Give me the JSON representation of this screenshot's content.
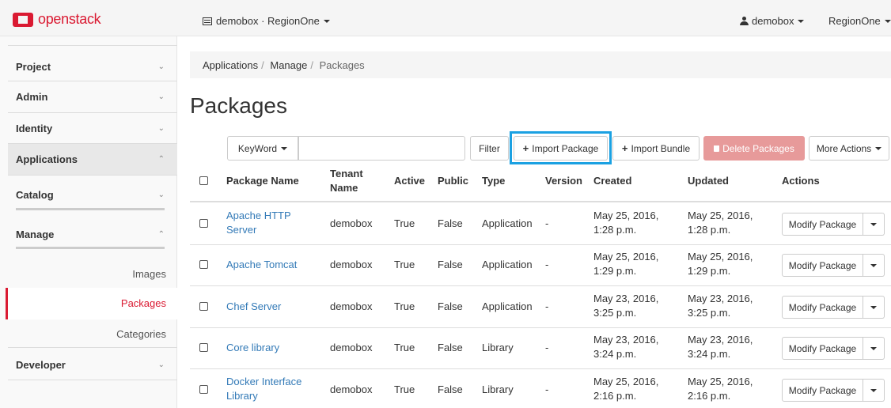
{
  "brand": {
    "name": "openstack",
    "color": "#da1a32"
  },
  "topbar": {
    "project_switch": "demobox · RegionOne",
    "user": "demobox",
    "region": "RegionOne"
  },
  "sidebar": {
    "project": "Project",
    "admin": "Admin",
    "identity": "Identity",
    "applications": "Applications",
    "catalog": "Catalog",
    "manage": "Manage",
    "images": "Images",
    "packages": "Packages",
    "categories": "Categories",
    "developer": "Developer"
  },
  "breadcrumb": {
    "part1": "Applications",
    "part2": "Manage",
    "part3": "Packages"
  },
  "page_title": "Packages",
  "toolbar": {
    "filter_field": "KeyWord",
    "filter_value": "",
    "filter_button": "Filter",
    "import_package": "Import Package",
    "import_bundle": "Import Bundle",
    "delete_packages": "Delete Packages",
    "more_actions": "More Actions"
  },
  "table": {
    "headers": {
      "name": "Package Name",
      "tenant_line1": "Tenant",
      "tenant_line2": "Name",
      "active": "Active",
      "public": "Public",
      "type": "Type",
      "version": "Version",
      "created": "Created",
      "updated": "Updated",
      "actions": "Actions"
    },
    "rows": [
      {
        "name_line1": "Apache HTTP",
        "name_line2": "Server",
        "tenant": "demobox",
        "active": "True",
        "public": "False",
        "type": "Application",
        "version": "-",
        "created_line1": "May 25, 2016,",
        "created_line2": "1:28 p.m.",
        "updated_line1": "May 25, 2016,",
        "updated_line2": "1:28 p.m.",
        "action": "Modify Package"
      },
      {
        "name_line1": "Apache Tomcat",
        "name_line2": "",
        "tenant": "demobox",
        "active": "True",
        "public": "False",
        "type": "Application",
        "version": "-",
        "created_line1": "May 25, 2016,",
        "created_line2": "1:29 p.m.",
        "updated_line1": "May 25, 2016,",
        "updated_line2": "1:29 p.m.",
        "action": "Modify Package"
      },
      {
        "name_line1": "Chef Server",
        "name_line2": "",
        "tenant": "demobox",
        "active": "True",
        "public": "False",
        "type": "Application",
        "version": "-",
        "created_line1": "May 23, 2016,",
        "created_line2": "3:25 p.m.",
        "updated_line1": "May 23, 2016,",
        "updated_line2": "3:25 p.m.",
        "action": "Modify Package"
      },
      {
        "name_line1": "Core library",
        "name_line2": "",
        "tenant": "demobox",
        "active": "True",
        "public": "False",
        "type": "Library",
        "version": "-",
        "created_line1": "May 23, 2016,",
        "created_line2": "3:24 p.m.",
        "updated_line1": "May 23, 2016,",
        "updated_line2": "3:24 p.m.",
        "action": "Modify Package"
      },
      {
        "name_line1": "Docker Interface",
        "name_line2": "Library",
        "tenant": "demobox",
        "active": "True",
        "public": "False",
        "type": "Library",
        "version": "-",
        "created_line1": "May 25, 2016,",
        "created_line2": "2:16 p.m.",
        "updated_line1": "May 25, 2016,",
        "updated_line2": "2:16 p.m.",
        "action": "Modify Package"
      }
    ]
  }
}
